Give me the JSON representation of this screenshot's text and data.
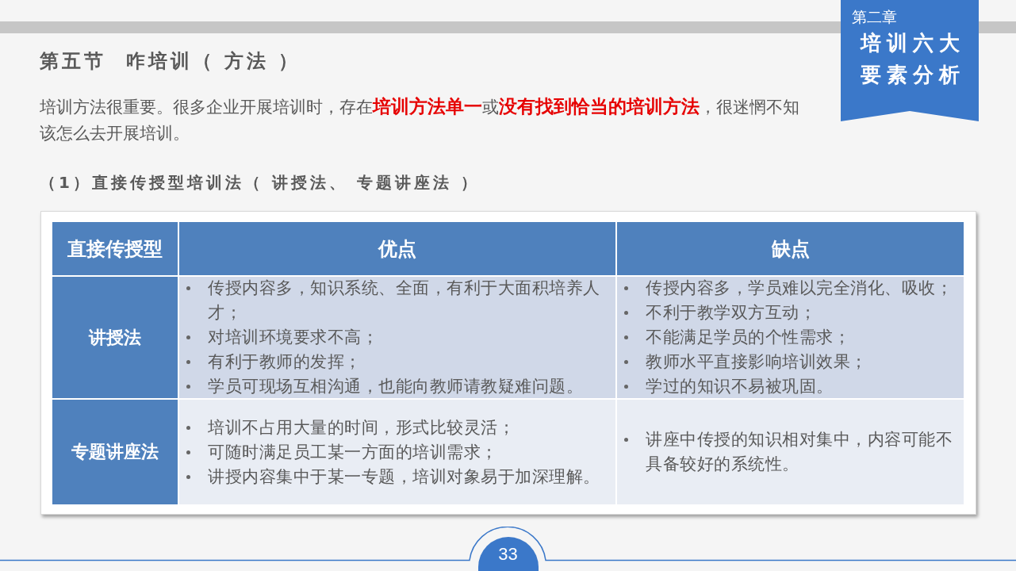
{
  "chapter_ribbon": {
    "chapter": "第二章",
    "title_lines": [
      "培训六大",
      "要素分析"
    ]
  },
  "page_title": "第五节  咋培训（ 方法 ）",
  "intro": "培训方法很重要。很多企业开展培训时，存在**培训方法单一**或**没有找到恰当的培训方法**，很迷惘不知该怎么去开展培训。",
  "section_heading": "（1）直接传授型培训法（ 讲授法、 专题讲座法 ）",
  "table": {
    "columns": [
      "直接传授型",
      "优点",
      "缺点"
    ],
    "rows": [
      {
        "method": "讲授法",
        "advantages": [
          "传授内容多，知识系统、全面，有利于大面积培养人才；",
          "对培训环境要求不高；",
          "有利于教师的发挥；",
          "学员可现场互相沟通，也能向教师请教疑难问题。"
        ],
        "disadvantages": [
          "传授内容多，学员难以完全消化、吸收；",
          "不利于教学双方互动；",
          "不能满足学员的个性需求；",
          "教师水平直接影响培训效果；",
          "学过的知识不易被巩固。"
        ]
      },
      {
        "method": "专题讲座法",
        "advantages": [
          "培训不占用大量的时间，形式比较灵活；",
          "可随时满足员工某一方面的培训需求；",
          "讲授内容集中于某一专题，培训对象易于加深理解。"
        ],
        "disadvantages": [
          "讲座中传授的知识相对集中，内容可能不具备较好的系统性。"
        ]
      }
    ]
  },
  "page_number": "33"
}
